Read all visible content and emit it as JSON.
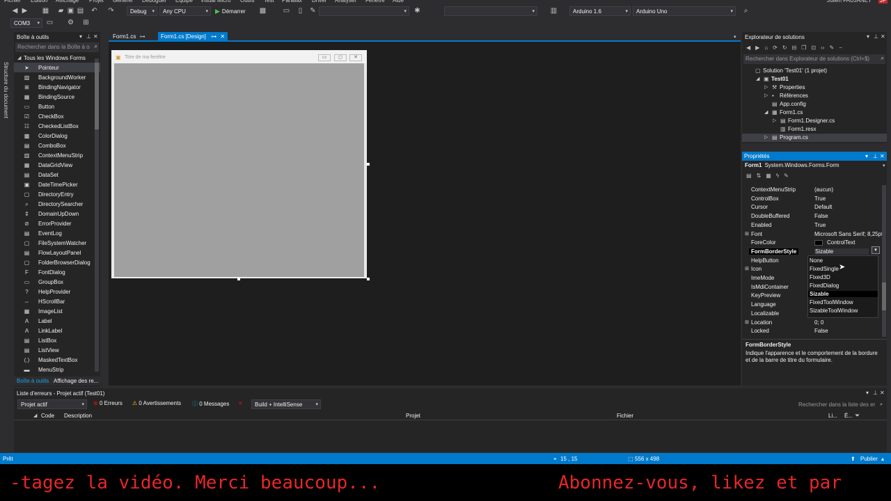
{
  "menu": [
    "Fichier",
    "Edition",
    "Affichage",
    "Projet",
    "Générer",
    "Déboguer",
    "Equipe",
    "Visual Micro",
    "Outils",
    "Test",
    "Parallax",
    "Driver",
    "Analyser",
    "Fenêtre",
    "Aide"
  ],
  "user": "Julien FAUJANET",
  "user_initials": "JF",
  "toolbar": {
    "config": "Debug",
    "platform": "Any CPU",
    "start": "Démarrer",
    "arduino_version": "Arduino 1.6",
    "board": "Arduino Uno",
    "port": "COM3"
  },
  "left_tab": "Structure du document",
  "toolbox": {
    "title": "Boîte à outils",
    "search_placeholder": "Rechercher dans la Boîte à o",
    "group": "Tous les Windows Forms",
    "items": [
      {
        "label": "Pointeur",
        "icon": "pointer-icon"
      },
      {
        "label": "BackgroundWorker",
        "icon": "backgroundworker-icon"
      },
      {
        "label": "BindingNavigator",
        "icon": "bindingnavigator-icon"
      },
      {
        "label": "BindingSource",
        "icon": "bindingsource-icon"
      },
      {
        "label": "Button",
        "icon": "button-icon"
      },
      {
        "label": "CheckBox",
        "icon": "checkbox-icon"
      },
      {
        "label": "CheckedListBox",
        "icon": "checkedlistbox-icon"
      },
      {
        "label": "ColorDialog",
        "icon": "colordialog-icon"
      },
      {
        "label": "ComboBox",
        "icon": "combobox-icon"
      },
      {
        "label": "ContextMenuStrip",
        "icon": "contextmenustrip-icon"
      },
      {
        "label": "DataGridView",
        "icon": "datagridview-icon"
      },
      {
        "label": "DataSet",
        "icon": "dataset-icon"
      },
      {
        "label": "DateTimePicker",
        "icon": "datetimepicker-icon"
      },
      {
        "label": "DirectoryEntry",
        "icon": "directoryentry-icon"
      },
      {
        "label": "DirectorySearcher",
        "icon": "directorysearcher-icon"
      },
      {
        "label": "DomainUpDown",
        "icon": "domainupdown-icon"
      },
      {
        "label": "ErrorProvider",
        "icon": "errorprovider-icon"
      },
      {
        "label": "EventLog",
        "icon": "eventlog-icon"
      },
      {
        "label": "FileSystemWatcher",
        "icon": "filesystemwatcher-icon"
      },
      {
        "label": "FlowLayoutPanel",
        "icon": "flowlayoutpanel-icon"
      },
      {
        "label": "FolderBrowserDialog",
        "icon": "folderbrowserdialog-icon"
      },
      {
        "label": "FontDialog",
        "icon": "fontdialog-icon"
      },
      {
        "label": "GroupBox",
        "icon": "groupbox-icon"
      },
      {
        "label": "HelpProvider",
        "icon": "helpprovider-icon"
      },
      {
        "label": "HScrollBar",
        "icon": "hscrollbar-icon"
      },
      {
        "label": "ImageList",
        "icon": "imagelist-icon"
      },
      {
        "label": "Label",
        "icon": "label-icon"
      },
      {
        "label": "LinkLabel",
        "icon": "linklabel-icon"
      },
      {
        "label": "ListBox",
        "icon": "listbox-icon"
      },
      {
        "label": "ListView",
        "icon": "listview-icon"
      },
      {
        "label": "MaskedTextBox",
        "icon": "maskedtextbox-icon"
      },
      {
        "label": "MenuStrip",
        "icon": "menustrip-icon"
      }
    ],
    "bottom_tabs": [
      "Boîte à outils",
      "Affichage des re..."
    ]
  },
  "doc_tabs": [
    "Form1.cs",
    "Form1.cs [Design]"
  ],
  "designer_form": {
    "title": "Titre de ma fenêtre"
  },
  "solution_explorer": {
    "title": "Explorateur de solutions",
    "search_placeholder": "Rechercher dans Explorateur de solutions (Ctrl+$)",
    "tree": [
      {
        "label": "Solution 'Test01' (1 projet)",
        "depth": 0,
        "twisty": "",
        "icon": "solution-icon"
      },
      {
        "label": "Test01",
        "depth": 1,
        "twisty": "◢",
        "icon": "csharp-project-icon",
        "bold": true
      },
      {
        "label": "Properties",
        "depth": 2,
        "twisty": "▷",
        "icon": "wrench-icon"
      },
      {
        "label": "Références",
        "depth": 2,
        "twisty": "▷",
        "icon": "references-icon"
      },
      {
        "label": "App.config",
        "depth": 2,
        "twisty": "",
        "icon": "config-file-icon"
      },
      {
        "label": "Form1.cs",
        "depth": 2,
        "twisty": "◢",
        "icon": "form-icon"
      },
      {
        "label": "Form1.Designer.cs",
        "depth": 3,
        "twisty": "▷",
        "icon": "cs-file-icon"
      },
      {
        "label": "Form1.resx",
        "depth": 3,
        "twisty": "",
        "icon": "resx-file-icon"
      },
      {
        "label": "Program.cs",
        "depth": 2,
        "twisty": "▷",
        "icon": "cs-file-icon",
        "selected": true
      }
    ]
  },
  "properties": {
    "title": "Propriétés",
    "object_name": "Form1",
    "object_type": "System.Windows.Forms.Form",
    "rows": [
      {
        "name": "ContextMenuStrip",
        "value": "(aucun)"
      },
      {
        "name": "ControlBox",
        "value": "True"
      },
      {
        "name": "Cursor",
        "value": "Default"
      },
      {
        "name": "DoubleBuffered",
        "value": "False"
      },
      {
        "name": "Enabled",
        "value": "True"
      },
      {
        "name": "Font",
        "value": "Microsoft Sans Serif; 8,25pt",
        "expand": "⊞"
      },
      {
        "name": "ForeColor",
        "value": "ControlText",
        "swatch": "#000000"
      },
      {
        "name": "FormBorderStyle",
        "value": "Sizable",
        "selected": true
      },
      {
        "name": "HelpButton",
        "value": ""
      },
      {
        "name": "Icon",
        "value": "",
        "expand": "⊞"
      },
      {
        "name": "ImeMode",
        "value": ""
      },
      {
        "name": "IsMdiContainer",
        "value": ""
      },
      {
        "name": "KeyPreview",
        "value": ""
      },
      {
        "name": "Language",
        "value": ""
      },
      {
        "name": "Localizable",
        "value": ""
      },
      {
        "name": "Location",
        "value": "0; 0",
        "expand": "⊞"
      },
      {
        "name": "Locked",
        "value": "False"
      }
    ],
    "dropdown_options": [
      "None",
      "FixedSingle",
      "Fixed3D",
      "FixedDialog",
      "Sizable",
      "FixedToolWindow",
      "SizableToolWindow"
    ],
    "dropdown_selected": "Sizable",
    "description_title": "FormBorderStyle",
    "description_text": "Indique l'apparence et le comportement de la bordure et de la barre de titre du formulaire."
  },
  "error_list": {
    "title": "Liste d'erreurs - Projet actif (Test01)",
    "scope": "Projet actif",
    "errors": "0 Erreurs",
    "warnings": "0 Avertissements",
    "messages": "0 Messages",
    "build_filter": "Build + IntelliSense",
    "search_placeholder": "Rechercher dans la liste des er",
    "columns": [
      "Code",
      "Description",
      "Projet",
      "Fichier",
      "Li...",
      "É..."
    ]
  },
  "status": {
    "left": "Prêt",
    "position": "15 , 15",
    "size": "556 x 498",
    "publish": "Publier"
  },
  "subtitle": {
    "left": "-tagez la vidéo. Merci beaucoup...",
    "right": "Abonnez-vous, likez et par"
  },
  "colors": {
    "accent": "#007acc",
    "subtitle_red": "#e8262a",
    "error_red": "#e51400",
    "warning_yellow": "#ffcc00",
    "info_blue": "#1ba1e2"
  }
}
